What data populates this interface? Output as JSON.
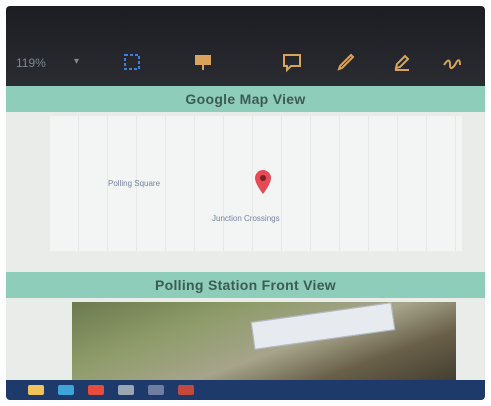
{
  "toolbar": {
    "zoom": "119%",
    "zoom_caret": "▾",
    "buttons": [
      {
        "icon": "select-icon"
      },
      {
        "icon": "presentation-icon"
      },
      {
        "icon": "comment-icon"
      },
      {
        "icon": "pen-icon"
      },
      {
        "icon": "highlighter-icon"
      },
      {
        "icon": "signature-icon"
      }
    ]
  },
  "sections": {
    "map_title": "Google Map View",
    "front_title": "Polling Station Front View"
  },
  "map": {
    "label_left": "Polling Square",
    "label_bottom": "Junction Crossings"
  },
  "colors": {
    "banner": "#8fcdbb",
    "toolbar": "#1b1d22",
    "taskbar": "#1d3a6a",
    "pin": "#e64b55"
  }
}
